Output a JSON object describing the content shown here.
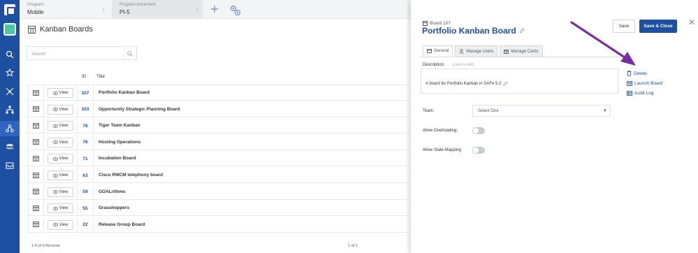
{
  "topbar": {
    "program_label": "Program:",
    "program_value": "Mobile",
    "pi_label": "Program Increment:",
    "pi_value": "PI-5"
  },
  "page": {
    "title": "Kanban Boards"
  },
  "search": {
    "placeholder": "Search"
  },
  "table": {
    "columns": [
      "ID",
      "Title"
    ],
    "view_label": "View",
    "rows": [
      {
        "id": "107",
        "title": "Portfolio Kanban Board"
      },
      {
        "id": "103",
        "title": "Opportunity Strategic Planning Board"
      },
      {
        "id": "78",
        "title": "Tiger Team Kanban"
      },
      {
        "id": "76",
        "title": "Hosting Operations"
      },
      {
        "id": "71",
        "title": "Incubation Board"
      },
      {
        "id": "63",
        "title": "Cisco RMCM telephony board"
      },
      {
        "id": "59",
        "title": "GOALrithms"
      },
      {
        "id": "55",
        "title": "Grasshoppers"
      },
      {
        "id": "22",
        "title": "Release Group Board"
      }
    ],
    "records_text": "1-9 of 9 Records",
    "page_text": "1 of 1"
  },
  "panel": {
    "subtitle": "Board 107",
    "title": "Portfolio Kanban Board",
    "save_label": "Save",
    "save_close_label": "Save & Close",
    "tabs": [
      "General",
      "Manage Users",
      "Manage Cards"
    ],
    "description_label": "Description:",
    "description_hint": "(click to edit)",
    "description_text": "A board for Portfolio Kanban in SAFe 5.0",
    "team_label": "Team:",
    "team_value": "Select One",
    "allow_overloading_label": "Allow Overloading:",
    "allow_state_mapping_label": "Allow State Mapping:",
    "actions": [
      "Delete",
      "Launch Board",
      "Audit Log"
    ]
  },
  "colors": {
    "nav": "#1e50a2",
    "accent": "#1e50a2",
    "arrow": "#7a2da0"
  }
}
